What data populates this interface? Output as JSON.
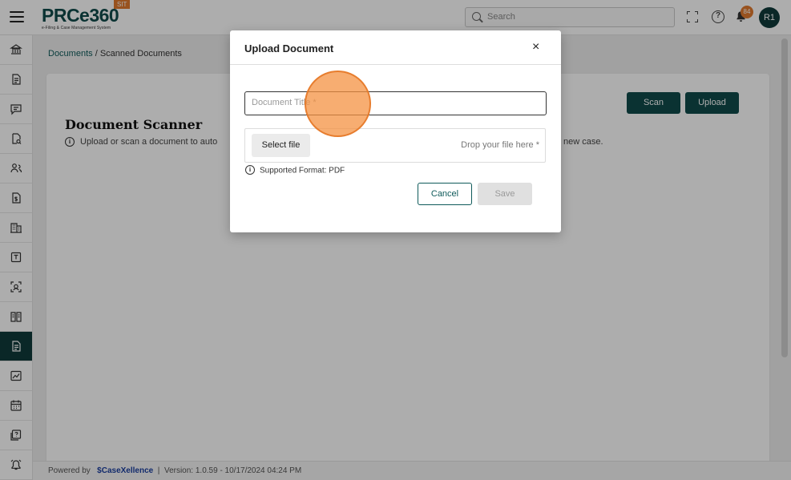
{
  "app": {
    "logo_text": "PRCe360",
    "logo_subtitle": "e-Filing & Case Management System",
    "env_badge": "SIT"
  },
  "header": {
    "search_placeholder": "Search",
    "notification_count": "84",
    "avatar_initials": "R1"
  },
  "sidebar": {
    "items": [
      {
        "icon": "bank-icon",
        "active": false
      },
      {
        "icon": "document-icon",
        "active": false
      },
      {
        "icon": "chat-icon",
        "active": false
      },
      {
        "icon": "document-search-icon",
        "active": false
      },
      {
        "icon": "users-icon",
        "active": false
      },
      {
        "icon": "file-dollar-icon",
        "active": false
      },
      {
        "icon": "building-icon",
        "active": false
      },
      {
        "icon": "text-box-icon",
        "active": false
      },
      {
        "icon": "scan-face-icon",
        "active": false
      },
      {
        "icon": "book-icon",
        "active": false
      },
      {
        "icon": "scanned-document-icon",
        "active": true
      },
      {
        "icon": "chart-icon",
        "active": false
      },
      {
        "icon": "calendar-icon",
        "active": false
      },
      {
        "icon": "help-book-icon",
        "active": false
      },
      {
        "icon": "alarm-icon",
        "active": false
      }
    ]
  },
  "breadcrumb": {
    "parent": "Documents",
    "separator": " / ",
    "current": "Scanned Documents"
  },
  "page": {
    "title": "Document Scanner",
    "description": "Upload or scan a document to auto",
    "description_tail": "new case.",
    "scan_label": "Scan",
    "upload_label": "Upload"
  },
  "modal": {
    "title": "Upload Document",
    "close_glyph": "×",
    "title_placeholder": "Document Title *",
    "select_file_label": "Select file",
    "drop_text": "Drop your file here *",
    "format_note": "Supported Format: PDF",
    "cancel_label": "Cancel",
    "save_label": "Save"
  },
  "footer": {
    "powered_by": "Powered by",
    "brand": "CaseXellence",
    "separator": "|",
    "version": "Version: 1.0.59 - 10/17/2024 04:24 PM"
  },
  "colors": {
    "primary": "#0f4a4a",
    "accent": "#e07a2e"
  }
}
